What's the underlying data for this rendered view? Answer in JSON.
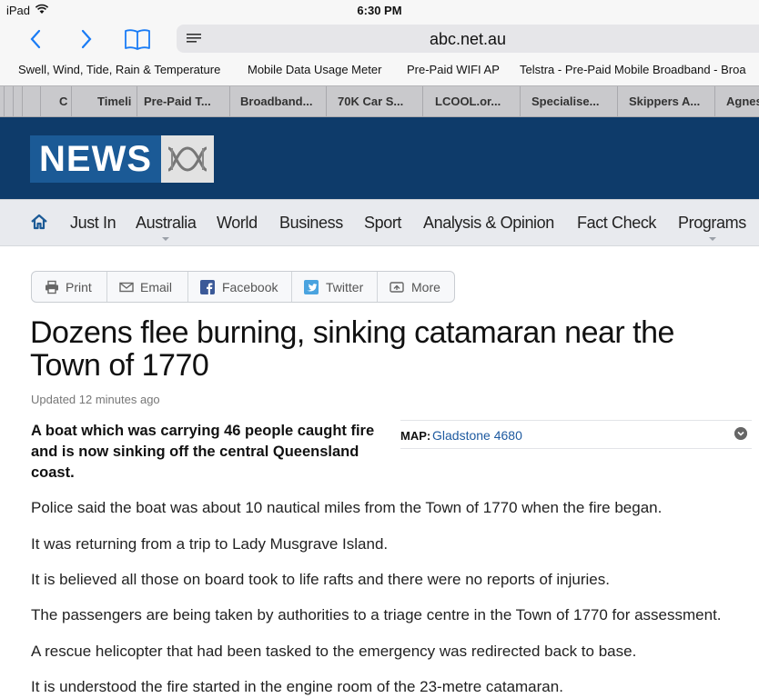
{
  "status_bar": {
    "device": "iPad",
    "time": "6:30 PM"
  },
  "browser": {
    "url": "abc.net.au",
    "favorites": [
      "Swell, Wind, Tide, Rain & Temperature",
      "Mobile Data Usage Meter",
      "Pre-Paid WIFI AP",
      "Telstra - Pre-Paid Mobile Broadband - Broa"
    ],
    "tabs": [
      "C",
      "Timeli",
      "Pre-Paid T...",
      "Broadband...",
      "70K Car S...",
      "LCOOL.or...",
      "Specialise...",
      "Skippers A...",
      "Agnes"
    ]
  },
  "site": {
    "logo_text": "NEWS",
    "nav": [
      "Just In",
      "Australia",
      "World",
      "Business",
      "Sport",
      "Analysis & Opinion",
      "Fact Check",
      "Programs"
    ]
  },
  "share": {
    "print": "Print",
    "email": "Email",
    "facebook": "Facebook",
    "twitter": "Twitter",
    "more": "More"
  },
  "colors": {
    "header_bg": "#0e3b6a",
    "logo_bg": "#1b5a96",
    "link": "#1e5aa0",
    "facebook": "#3b5998",
    "twitter": "#4aa3df"
  },
  "article": {
    "headline": "Dozens flee burning, sinking catamaran near the Town of 1770",
    "updated": "Updated 12 minutes ago",
    "lead": "A boat which was carrying 46 people caught fire and is now sinking off the central Queensland coast.",
    "map_label": "MAP:",
    "map_link": "Gladstone 4680",
    "paragraphs": [
      "Police said the boat was about 10 nautical miles from the Town of 1770 when the fire began.",
      "It was returning from a trip to Lady Musgrave Island.",
      "It is believed all those on board took to life rafts and there were no reports of injuries.",
      "The passengers are being taken by authorities to a triage centre in the Town of 1770 for assessment.",
      "A rescue helicopter that had been tasked to the emergency was redirected back to base.",
      "It is understood the fire started in the engine room of the 23-metre catamaran."
    ]
  }
}
